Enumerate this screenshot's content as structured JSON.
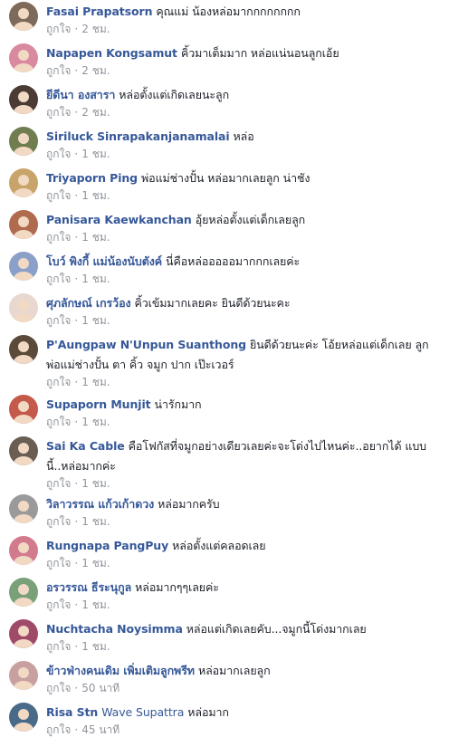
{
  "comments": [
    {
      "author": "Fasai Prapatsorn",
      "text": "คุณแม่ น้องหล่อมากกกกกกกก",
      "like": "ถูกใจ",
      "time": "2 ชม.",
      "avatar_color": "#7d6a5a"
    },
    {
      "author": "Napapen Kongsamut",
      "text": "คิ้วมาเต็มมาก หล่อแน่นอนลูกเอ้ย",
      "like": "ถูกใจ",
      "time": "2 ชม.",
      "avatar_color": "#d98aa0"
    },
    {
      "author": "ยีดีนา องสารา",
      "text": "หล่อตั้งแต่เกิดเลยนะลูก",
      "like": "ถูกใจ",
      "time": "2 ชม.",
      "avatar_color": "#4a3b34"
    },
    {
      "author": "Siriluck Sinrapakanjanamalai",
      "text": "หล่อ",
      "like": "ถูกใจ",
      "time": "1 ชม.",
      "avatar_color": "#6f7d4f"
    },
    {
      "author": "Triyaporn Ping",
      "text": "พ่อแม่ช่างปั้น หล่อมากเลยลูก น่าชัง",
      "like": "ถูกใจ",
      "time": "1 ชม.",
      "avatar_color": "#c9a46a"
    },
    {
      "author": "Panisara Kaewkanchan",
      "text": "อุ้ยหล่อตั้งแต่เด็กเลยลูก",
      "like": "ถูกใจ",
      "time": "1 ชม.",
      "avatar_color": "#b06a4e"
    },
    {
      "author": "โบว์ พิงกี้ แม่น้องนับตังค์",
      "text": "นี่คือหล่อออออมากกกเลยค่ะ",
      "like": "ถูกใจ",
      "time": "1 ชม.",
      "avatar_color": "#8aa0c8"
    },
    {
      "author": "ศุภลักษณ์ เกรว้อง",
      "text": "คิ้วเข้มมากเลยคะ ยินดีด้วยนะคะ",
      "like": "ถูกใจ",
      "time": "1 ชม.",
      "avatar_color": "#e8d8d0"
    },
    {
      "author": "P'Aungpaw N'Unpun Suanthong",
      "text": "ยินดีด้วยนะค่ะ โอ้ยหล่อแต่เด็กเลย ลูก พ่อแม่ช่างปั้น ตา คิ้ว จมูก ปาก เป๊ะเวอร์",
      "like": "ถูกใจ",
      "time": "1 ชม.",
      "avatar_color": "#5b4a3a"
    },
    {
      "author": "Supaporn Munjit",
      "text": "น่ารักมาก",
      "like": "ถูกใจ",
      "time": "1 ชม.",
      "avatar_color": "#c45a4a"
    },
    {
      "author": "Sai Ka Cable",
      "text": "คือโฟกัสที่จมูกอย่างเดียวเลยค่ะจะโด่งไปไหนค่ะ..อยากได้ แบบนี้..หล่อมากค่ะ",
      "like": "ถูกใจ",
      "time": "1 ชม.",
      "avatar_color": "#6a5d52"
    },
    {
      "author": "วิลาวรรณ แก้วเก้าดวง",
      "text": "หล่อมากครับ",
      "like": "ถูกใจ",
      "time": "1 ชม.",
      "avatar_color": "#9a9a9a"
    },
    {
      "author": "Rungnapa PangPuy",
      "text": "หล่อตั้งแต่คลอดเลย",
      "like": "ถูกใจ",
      "time": "1 ชม.",
      "avatar_color": "#d27b8e"
    },
    {
      "author": "อรวรรณ ธีระนุกูล",
      "text": "หล่อมากๆๆเลยค่ะ",
      "like": "ถูกใจ",
      "time": "1 ชม.",
      "avatar_color": "#7aa07a"
    },
    {
      "author": "Nuchtacha Noysimma",
      "text": "หล่อแต่เกิดเลยคับ...จมูกนี้โด่งมากเลย",
      "like": "ถูกใจ",
      "time": "1 ชม.",
      "avatar_color": "#a04a6a"
    },
    {
      "author": "ข้าวฟ่างคนเดิม เพิ่มเติมลูกพรีท",
      "text": "หล่อมากเลยลูก",
      "like": "ถูกใจ",
      "time": "50 นาที",
      "avatar_color": "#c8a0a0"
    },
    {
      "author": "Risa Stn",
      "tag": "Wave Supattra",
      "text": "หล่อมาก",
      "like": "ถูกใจ",
      "time": "45 นาที",
      "avatar_color": "#4a6a8a"
    }
  ]
}
